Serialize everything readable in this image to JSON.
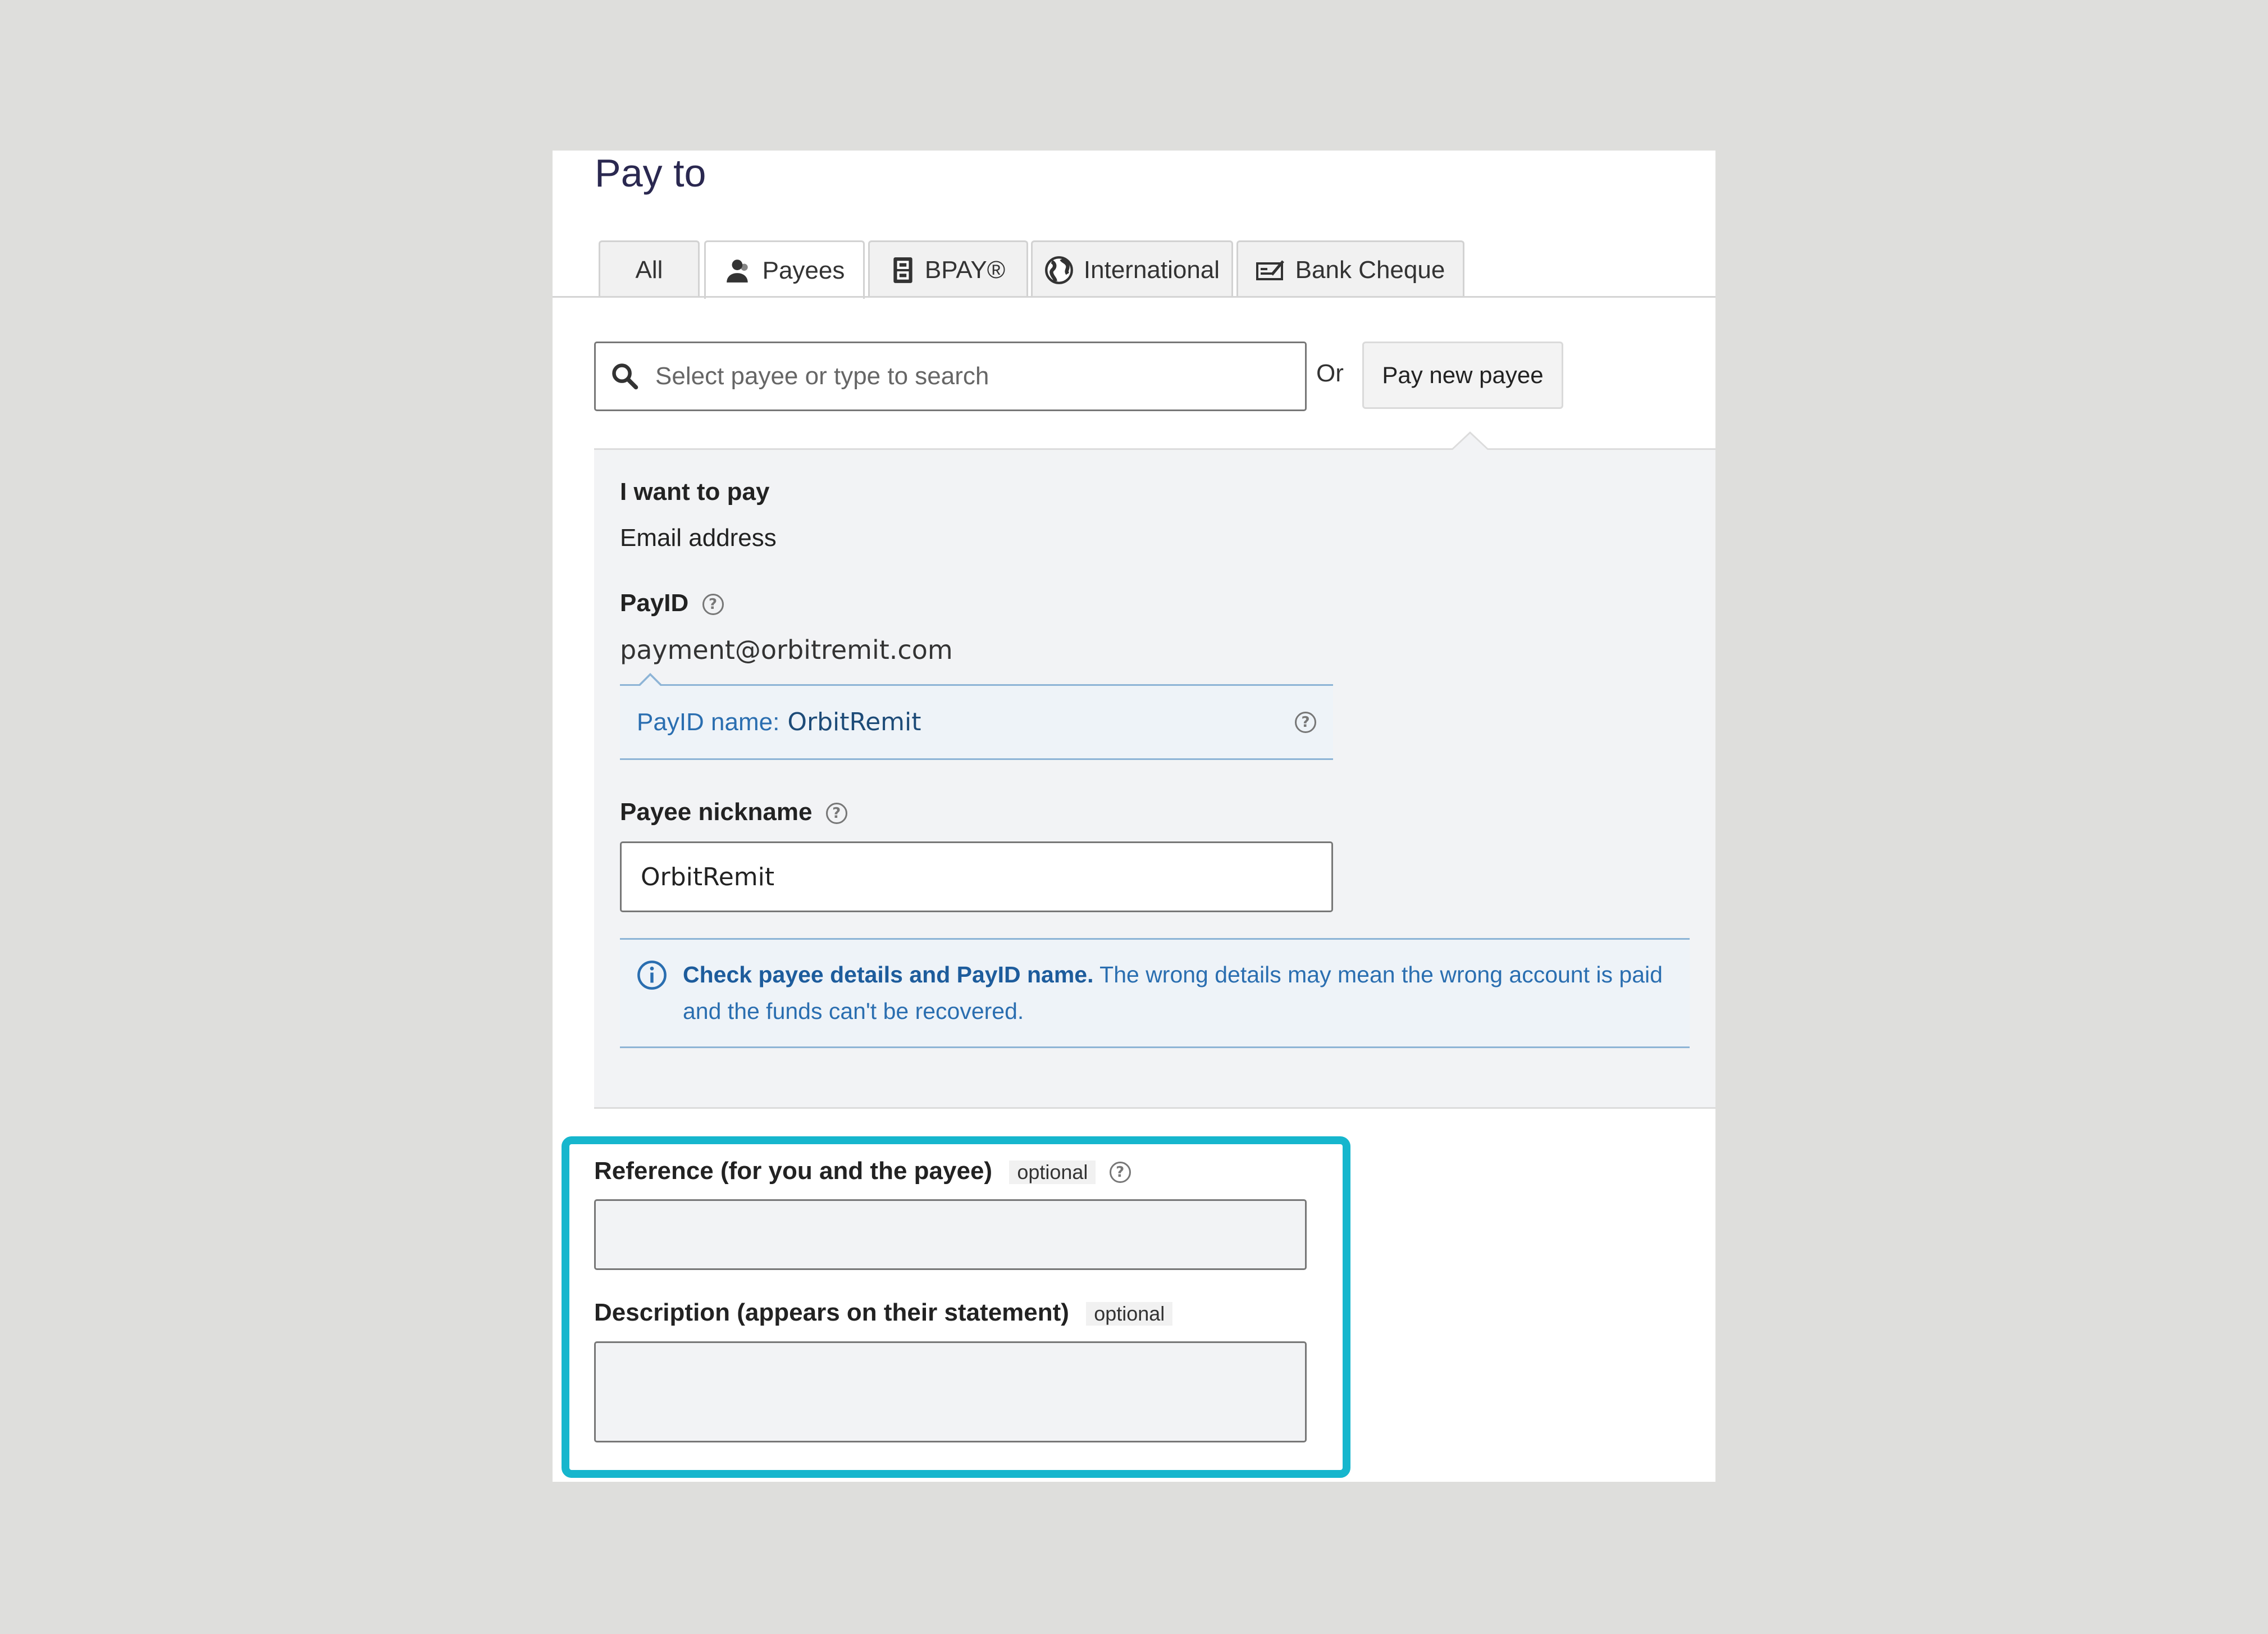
{
  "page": {
    "title": "Pay to"
  },
  "tabs": [
    {
      "label": "All",
      "icon": "none"
    },
    {
      "label": "Payees",
      "icon": "person-icon"
    },
    {
      "label": "BPAY®",
      "icon": "bpay-icon"
    },
    {
      "label": "International",
      "icon": "globe-icon"
    },
    {
      "label": "Bank Cheque",
      "icon": "cheque-icon"
    }
  ],
  "search": {
    "placeholder": "Select payee or type to search",
    "or_label": "Or",
    "pay_new_label": "Pay new payee"
  },
  "new_payee": {
    "want_to_pay_label": "I want to pay",
    "want_to_pay_value": "Email address",
    "payid_label": "PayID",
    "payid_value": "payment@orbitremit.com",
    "payid_name_label": "PayID name:",
    "payid_name_value": "OrbitRemit",
    "nickname_label": "Payee nickname",
    "nickname_value": "OrbitRemit",
    "notice_bold": "Check payee details and PayID name.",
    "notice_text": " The wrong details may mean the wrong account is paid and the funds can't be recovered."
  },
  "reference": {
    "label": "Reference (for you and the payee)",
    "optional": "optional",
    "value": ""
  },
  "description": {
    "label": "Description (appears on their statement)",
    "optional": "optional",
    "value": ""
  },
  "colors": {
    "highlight": "#16b6cd",
    "info_blue": "#2a6eb0",
    "title": "#2a2850"
  }
}
